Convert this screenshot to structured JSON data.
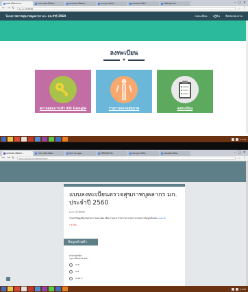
{
  "screen1": {
    "tabs": [
      {
        "title": "ลงทะเบียน ตรวจ..."
      },
      {
        "title": "ระบบ ลงทะเบียนต..."
      },
      {
        "title": "แบบลงทะเบียนตร..."
      },
      {
        "title": "Google ฟอร์ม..."
      },
      {
        "title": "แบบลงทะเบียน..."
      },
      {
        "title": "คลินิกสุขภาพ..."
      },
      {
        "title": "แบบ Google..."
      }
    ],
    "url": "ku.ac.th/2560",
    "brand": "โครงการตรวจสุขภาพบุคลากร มก. ประจำปี 2560",
    "nav_links": [
      "ลงทะเบียน",
      "ปฏิทิน",
      "ติดต่อสอบถาม"
    ],
    "section_title": "ลงทะเบียน",
    "cards": [
      {
        "label": "ตรวจสอบการเข้า KU Google",
        "icon": "key-icon"
      },
      {
        "label": "รายการตรวจสุขภาพ",
        "icon": "body-icon"
      },
      {
        "label": "ลงทะเบียน",
        "icon": "clipboard-icon"
      }
    ]
  },
  "screen2": {
    "tabs": [
      {
        "title": "แบบลงทะเบียนตร..."
      },
      {
        "title": "ระบบ ลงทะเบียน..."
      },
      {
        "title": "แบบ Google..."
      },
      {
        "title": "คลินิกสุขภาพ..."
      },
      {
        "title": "Google ฟอร์ม..."
      },
      {
        "title": "แบบลงทะเบียน..."
      },
      {
        "title": "ลงทะเบียน..."
      }
    ],
    "url": "docs.google.com/forms/d/e/",
    "form_title": "แบบลงทะเบียนตรวจสุขภาพบุคลากร มก. ประจำปี 2560",
    "form_account": "ku.th (ไม่ได้แชร์)",
    "form_desc_1": "โปรดใช้ข้อมูลที่ถูกต้องในการลงทะเบียน เพื่อความสะดวกในการตรวจสุขภาพ",
    "form_desc_2": "สอบถามข้อมูลเพิ่มเติม",
    "form_link": "ku.ac.th",
    "form_required": "* จำเป็น",
    "section_label": "ข้อมูลส่วนตัว",
    "question": "คำนำหน้าชื่อ *",
    "question_hint": "กรุณาเลือกคำนำหน้า",
    "options": [
      "นาย",
      "นาง",
      "นางสาว"
    ]
  },
  "taskbar": {
    "time": "11:20",
    "date": "3/1/2560"
  }
}
